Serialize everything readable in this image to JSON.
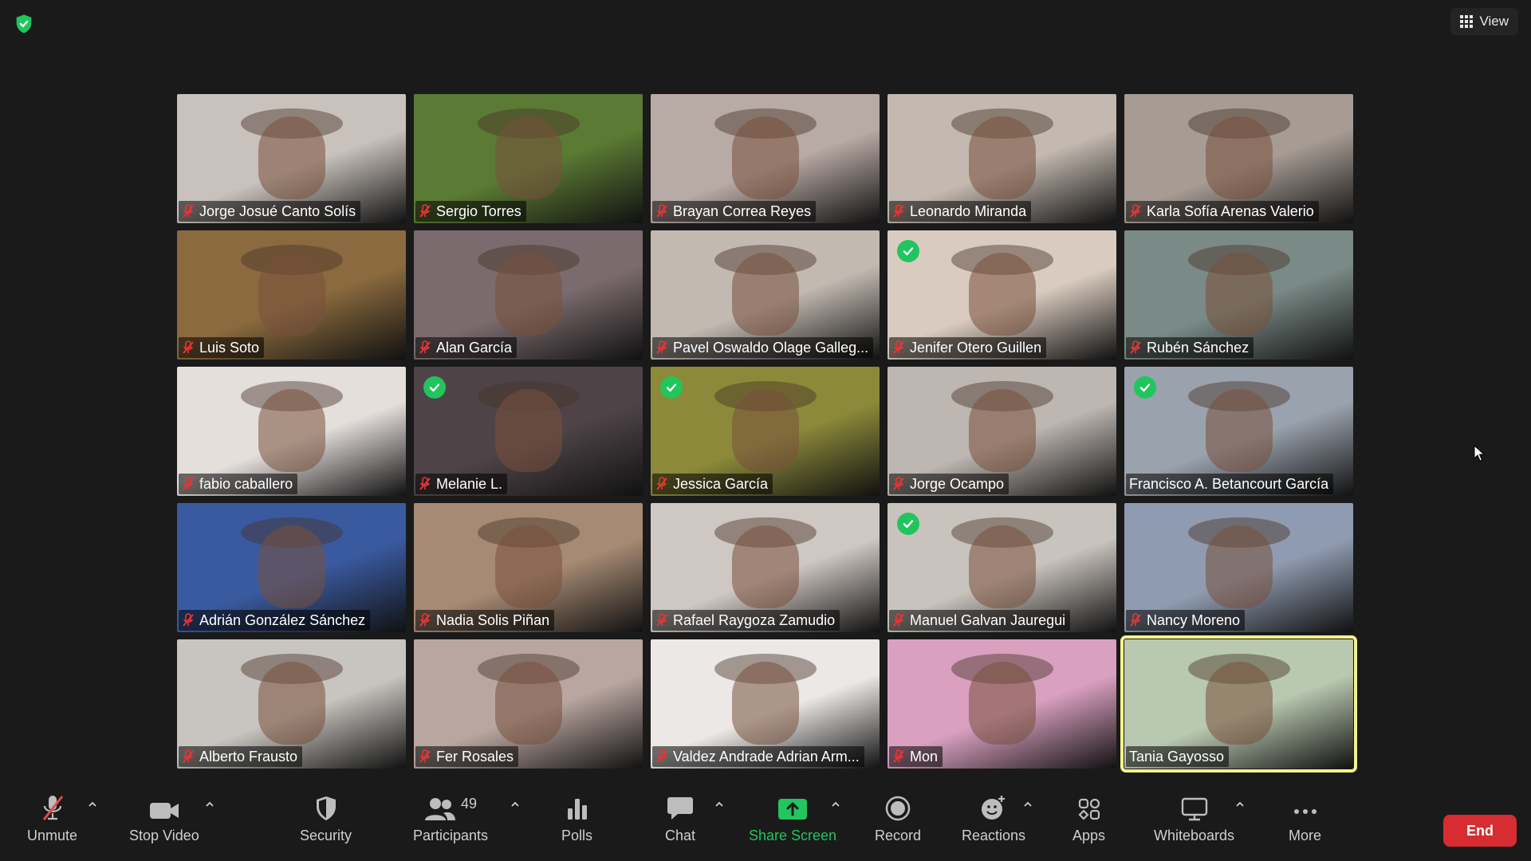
{
  "colors": {
    "background": "#1a1a1a",
    "accent_green": "#22c55e",
    "end_red": "#d72c31",
    "active_border": "#f2f28b"
  },
  "header": {
    "view_label": "View"
  },
  "participants_tiles": [
    {
      "name": "Jorge Josué Canto Solís",
      "muted": true,
      "verified": false,
      "active": false,
      "bg": "#c9c2bc"
    },
    {
      "name": "Sergio Torres",
      "muted": true,
      "verified": false,
      "active": false,
      "bg": "#5b7a34"
    },
    {
      "name": "Brayan Correa Reyes",
      "muted": true,
      "verified": false,
      "active": false,
      "bg": "#b8aaa5"
    },
    {
      "name": "Leonardo Miranda",
      "muted": true,
      "verified": false,
      "active": false,
      "bg": "#c3b9b0"
    },
    {
      "name": "Karla Sofía Arenas Valerio",
      "muted": true,
      "verified": false,
      "active": false,
      "bg": "#a69c94"
    },
    {
      "name": "Luis Soto",
      "muted": true,
      "verified": false,
      "active": false,
      "bg": "#8a6a3e"
    },
    {
      "name": "Alan García",
      "muted": true,
      "verified": false,
      "active": false,
      "bg": "#7b6b6e"
    },
    {
      "name": "Pavel Oswaldo Olage Galleg...",
      "muted": true,
      "verified": false,
      "active": false,
      "bg": "#c2b9b1"
    },
    {
      "name": "Jenifer Otero Guillen",
      "muted": true,
      "verified": true,
      "active": false,
      "bg": "#d9cbbf"
    },
    {
      "name": "Rubén Sánchez",
      "muted": true,
      "verified": false,
      "active": false,
      "bg": "#7a8a86"
    },
    {
      "name": "fabio caballero",
      "muted": true,
      "verified": false,
      "active": false,
      "bg": "#e5dfdc"
    },
    {
      "name": "Melanie L.",
      "muted": true,
      "verified": true,
      "active": false,
      "bg": "#4e4448"
    },
    {
      "name": "Jessica García",
      "muted": true,
      "verified": true,
      "active": false,
      "bg": "#8c8a3a"
    },
    {
      "name": "Jorge Ocampo",
      "muted": true,
      "verified": false,
      "active": false,
      "bg": "#bdb6b1"
    },
    {
      "name": "Francisco A. Betancourt García",
      "muted": false,
      "verified": true,
      "active": false,
      "bg": "#9aa2ad"
    },
    {
      "name": "Adrián González Sánchez",
      "muted": true,
      "verified": false,
      "active": false,
      "bg": "#3a5aa0"
    },
    {
      "name": "Nadia Solis Piñan",
      "muted": true,
      "verified": false,
      "active": false,
      "bg": "#a68a73"
    },
    {
      "name": "Rafael Raygoza Zamudio",
      "muted": true,
      "verified": false,
      "active": false,
      "bg": "#cfc7c2"
    },
    {
      "name": "Manuel  Galvan Jauregui",
      "muted": true,
      "verified": true,
      "active": false,
      "bg": "#c9c3bd"
    },
    {
      "name": "Nancy Moreno",
      "muted": true,
      "verified": false,
      "active": false,
      "bg": "#8f9bb0"
    },
    {
      "name": "Alberto Frausto",
      "muted": true,
      "verified": false,
      "active": false,
      "bg": "#c8c4bf"
    },
    {
      "name": "Fer Rosales",
      "muted": true,
      "verified": false,
      "active": false,
      "bg": "#b9a6a0"
    },
    {
      "name": "Valdez Andrade Adrian Arm...",
      "muted": true,
      "verified": false,
      "active": false,
      "bg": "#ebe8e6"
    },
    {
      "name": "Mon",
      "muted": true,
      "verified": false,
      "active": false,
      "bg": "#d9a0c0"
    },
    {
      "name": "Tania Gayosso",
      "muted": false,
      "verified": false,
      "active": true,
      "bg": "#b9c8b0"
    }
  ],
  "toolbar": {
    "unmute": "Unmute",
    "stop_video": "Stop Video",
    "security": "Security",
    "participants": "Participants",
    "participants_count": "49",
    "polls": "Polls",
    "chat": "Chat",
    "share_screen": "Share Screen",
    "record": "Record",
    "reactions": "Reactions",
    "apps": "Apps",
    "whiteboards": "Whiteboards",
    "more": "More",
    "end": "End"
  }
}
